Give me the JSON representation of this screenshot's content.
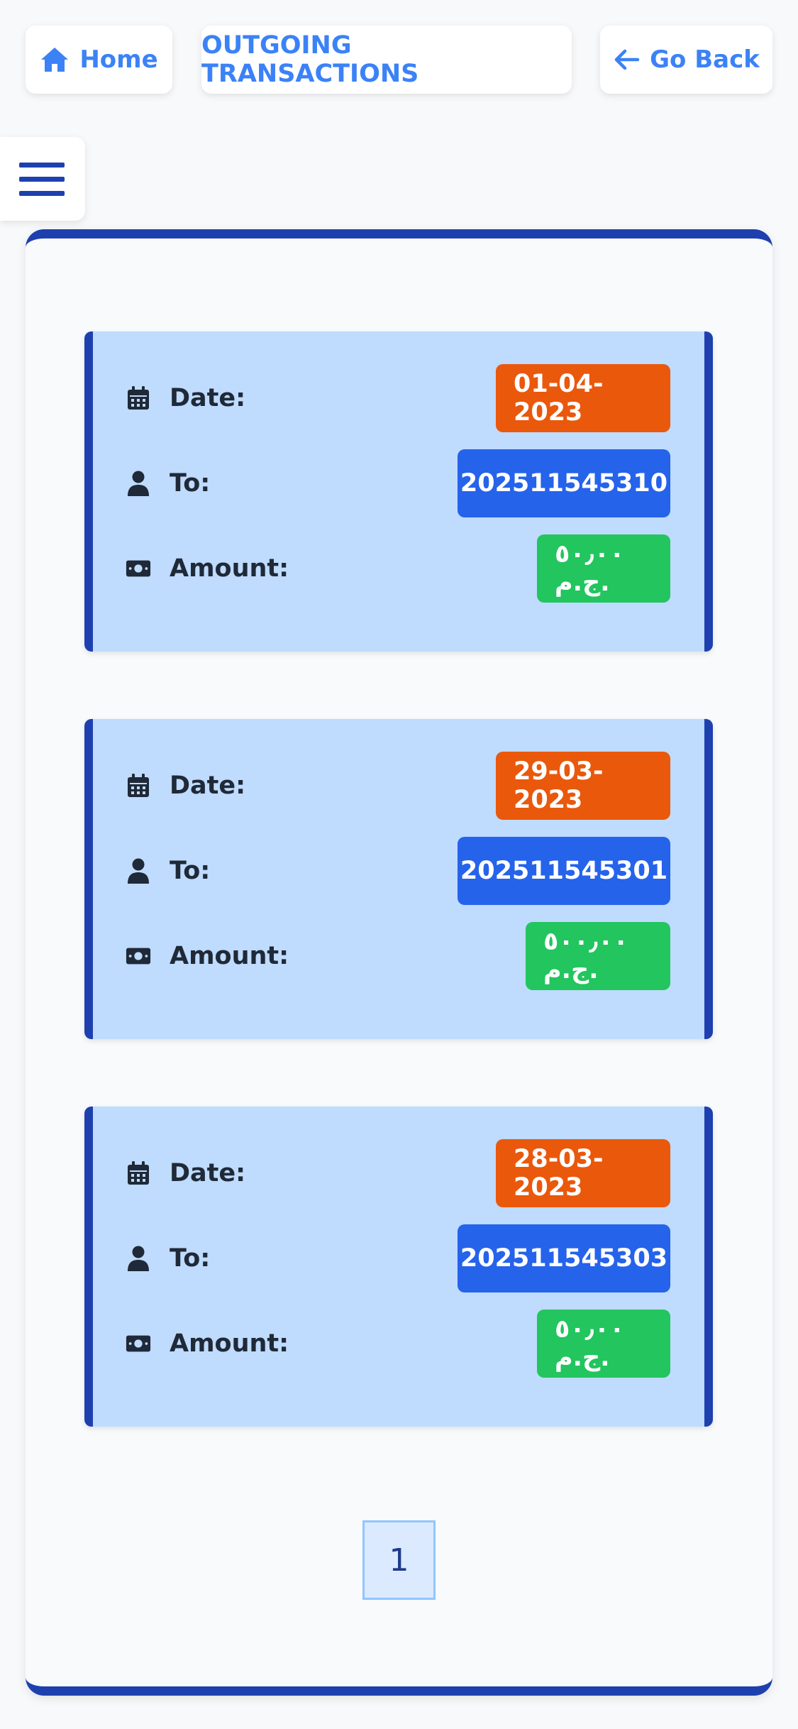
{
  "nav": {
    "home_label": "Home",
    "title_label": "OUTGOING TRANSACTIONS",
    "back_label": "Go Back"
  },
  "labels": {
    "date": "Date:",
    "to": "To:",
    "amount": "Amount:"
  },
  "transactions": [
    {
      "date": "01-04-2023",
      "to": "202511545310",
      "amount": "٥٠٫٠٠ ج.م."
    },
    {
      "date": "29-03-2023",
      "to": "202511545301",
      "amount": "٥٠٠٫٠٠ ج.م."
    },
    {
      "date": "28-03-2023",
      "to": "202511545303",
      "amount": "٥٠٫٠٠ ج.م."
    }
  ],
  "pagination": {
    "current_page": "1"
  },
  "colors": {
    "accent": "#1e40af",
    "link": "#3b82f6",
    "card_bg": "#bfdbfe",
    "date_badge": "#ea580c",
    "to_badge": "#2563eb",
    "amount_badge": "#22c55e"
  },
  "icons": [
    "home-icon",
    "arrow-left-icon",
    "hamburger-menu-icon",
    "calendar-icon",
    "user-icon",
    "money-bill-icon"
  ]
}
